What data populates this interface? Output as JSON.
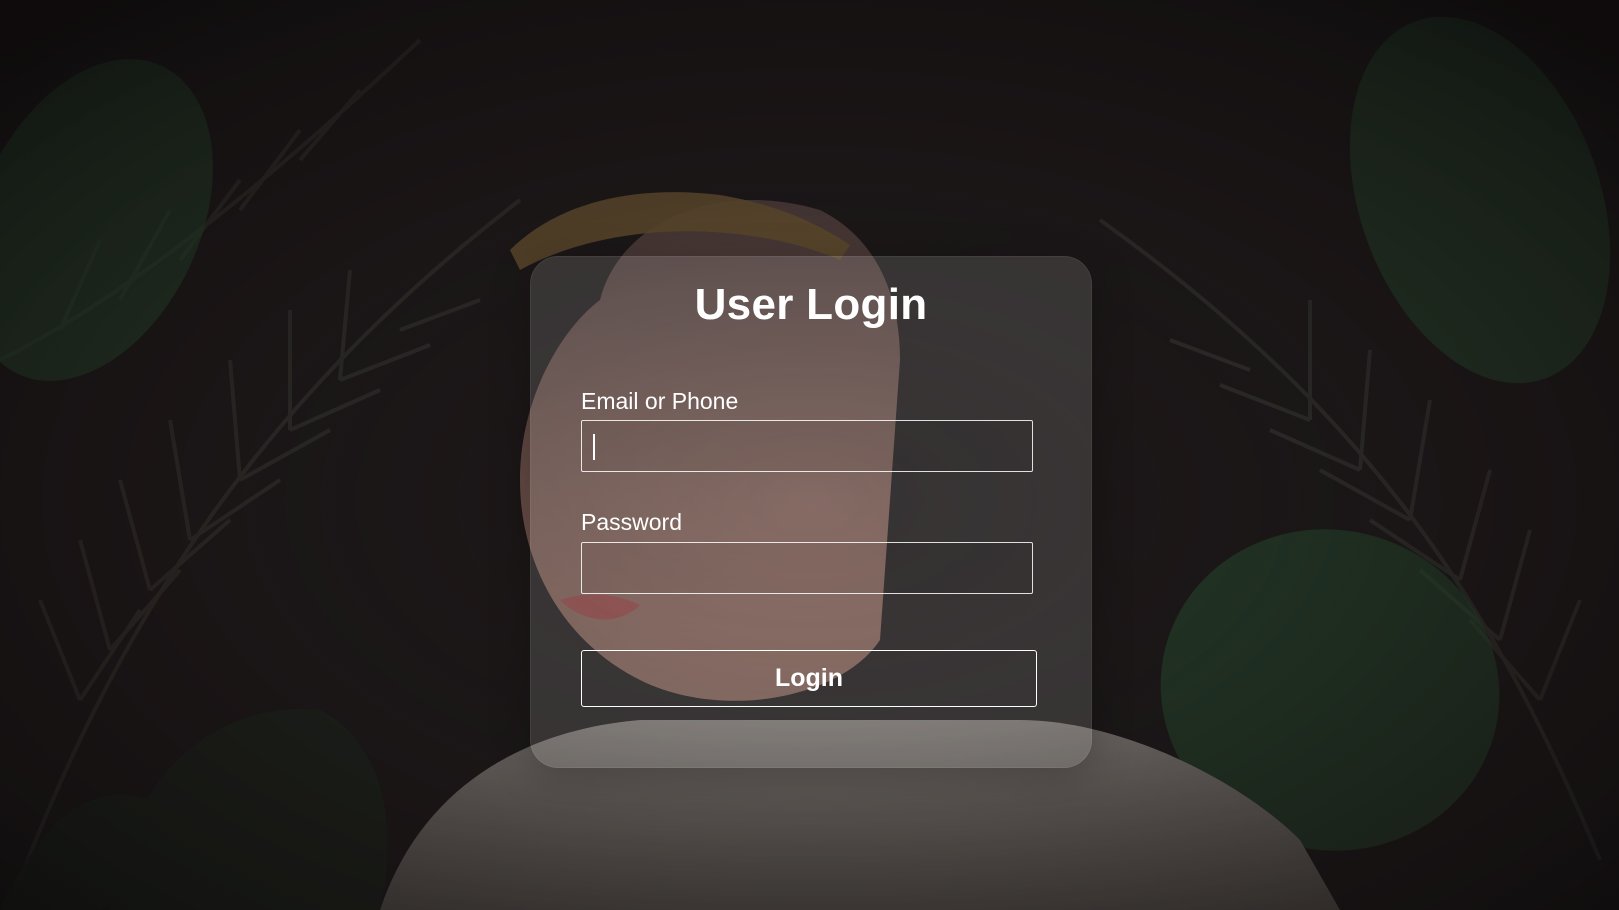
{
  "login_form": {
    "title": "User Login",
    "email_label": "Email or Phone",
    "email_value": "",
    "password_label": "Password",
    "password_value": "",
    "submit_label": "Login"
  },
  "background": {
    "description_icon": "background-photo",
    "colors": {
      "base": "#1c1617",
      "leaf_dark": "#2a2b27",
      "leaf_green": "#2f6a3c",
      "skin": "#9a6e63",
      "sweater": "#8c8680"
    }
  }
}
